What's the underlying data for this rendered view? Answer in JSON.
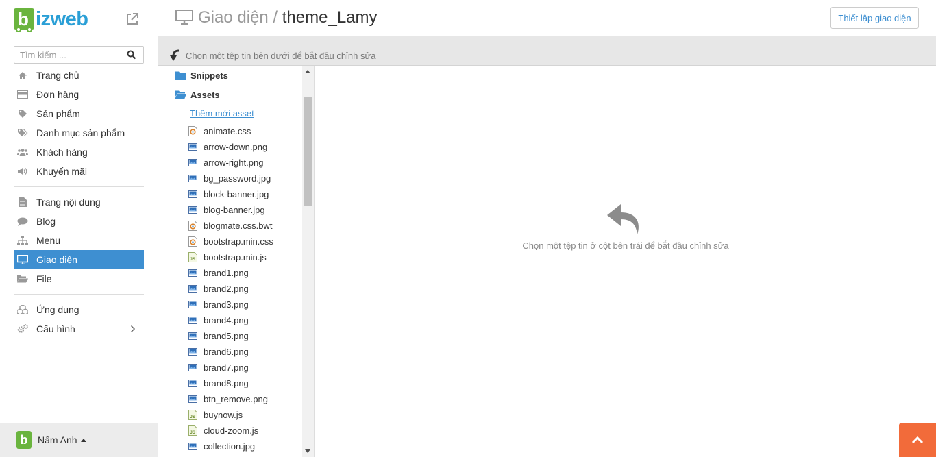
{
  "brand": {
    "logo_letter": "b",
    "logo_text": "izweb",
    "logo_color": "#2a9fd6",
    "logo_box_color": "#6ab43e"
  },
  "search": {
    "placeholder": "Tìm kiếm ..."
  },
  "sidebar": {
    "group1": [
      {
        "label": "Trang chủ",
        "icon": "home-icon"
      },
      {
        "label": "Đơn hàng",
        "icon": "credit-card-icon"
      },
      {
        "label": "Sản phẩm",
        "icon": "tag-icon"
      },
      {
        "label": "Danh mục sản phẩm",
        "icon": "tags-icon"
      },
      {
        "label": "Khách hàng",
        "icon": "users-icon"
      },
      {
        "label": "Khuyến mãi",
        "icon": "volume-icon"
      }
    ],
    "group2": [
      {
        "label": "Trang nội dung",
        "icon": "file-icon"
      },
      {
        "label": "Blog",
        "icon": "comment-icon"
      },
      {
        "label": "Menu",
        "icon": "sitemap-icon"
      },
      {
        "label": "Giao diện",
        "icon": "monitor-icon",
        "active": true
      },
      {
        "label": "File",
        "icon": "folder-open-icon"
      }
    ],
    "group3": [
      {
        "label": "Ứng dụng",
        "icon": "cubes-icon"
      },
      {
        "label": "Cấu hình",
        "icon": "cogs-icon"
      }
    ],
    "active_color": "#3e8fd1"
  },
  "user": {
    "name": "Nấm Anh",
    "avatar_letter": "b"
  },
  "header": {
    "section": "Giao diện",
    "separator": " / ",
    "theme": "theme_Lamy",
    "setup_button": "Thiết lập giao diện"
  },
  "hint": {
    "text": "Chọn một tệp tin bên dưới để bắt đầu chỉnh sửa"
  },
  "tree": {
    "folders": [
      "Snippets",
      "Assets"
    ],
    "add_asset": "Thêm mới asset",
    "files": [
      {
        "name": "animate.css",
        "type": "css"
      },
      {
        "name": "arrow-down.png",
        "type": "image"
      },
      {
        "name": "arrow-right.png",
        "type": "image"
      },
      {
        "name": "bg_password.jpg",
        "type": "image"
      },
      {
        "name": "block-banner.jpg",
        "type": "image"
      },
      {
        "name": "blog-banner.jpg",
        "type": "image"
      },
      {
        "name": "blogmate.css.bwt",
        "type": "css"
      },
      {
        "name": "bootstrap.min.css",
        "type": "css"
      },
      {
        "name": "bootstrap.min.js",
        "type": "js"
      },
      {
        "name": "brand1.png",
        "type": "image"
      },
      {
        "name": "brand2.png",
        "type": "image"
      },
      {
        "name": "brand3.png",
        "type": "image"
      },
      {
        "name": "brand4.png",
        "type": "image"
      },
      {
        "name": "brand5.png",
        "type": "image"
      },
      {
        "name": "brand6.png",
        "type": "image"
      },
      {
        "name": "brand7.png",
        "type": "image"
      },
      {
        "name": "brand8.png",
        "type": "image"
      },
      {
        "name": "btn_remove.png",
        "type": "image"
      },
      {
        "name": "buynow.js",
        "type": "js"
      },
      {
        "name": "cloud-zoom.js",
        "type": "js"
      },
      {
        "name": "collection.jpg",
        "type": "image"
      }
    ]
  },
  "editor": {
    "empty_text": "Chọn một tệp tin ở cột bên trái để bắt đầu chỉnh sửa"
  },
  "scroll_top_color": "#f26b3a"
}
